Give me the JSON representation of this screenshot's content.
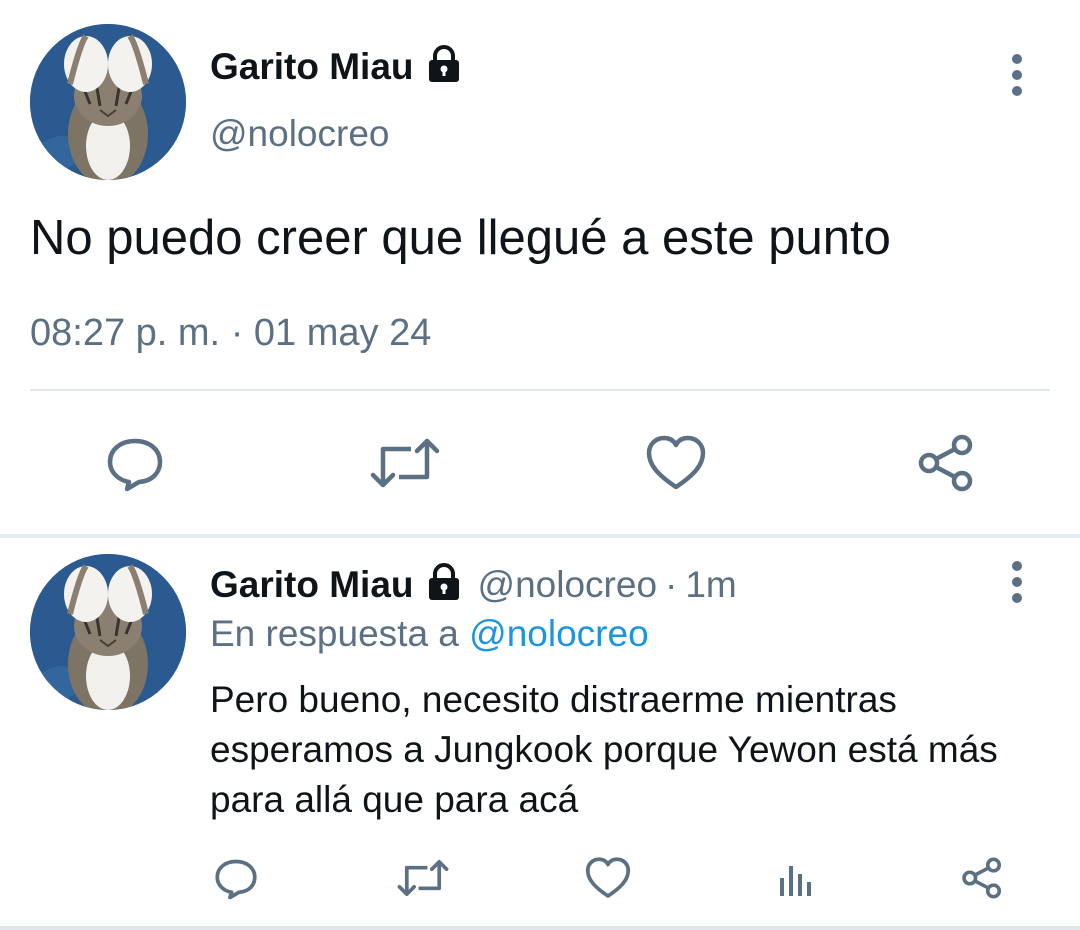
{
  "tweet": {
    "author_name": "Garito Miau",
    "handle": "@nolocreo",
    "text": "No puedo creer que llegué a este punto",
    "time": "08:27 p. m.",
    "separator": "·",
    "date": "01 may 24",
    "author_locked": true,
    "actions": [
      "reply",
      "retweet",
      "like",
      "share"
    ]
  },
  "reply": {
    "author_name": "Garito Miau",
    "handle": "@nolocreo",
    "separator": "·",
    "age": "1m",
    "replying_to_label": "En respuesta a",
    "replying_to_handle": "@nolocreo",
    "text": "Pero bueno, necesito distraerme mientras esperamos a Jungkook porque Yewon está más para allá que para acá",
    "author_locked": true,
    "actions": [
      "reply",
      "retweet",
      "like",
      "analytics",
      "share"
    ]
  },
  "colors": {
    "icon_gray": "#5b7083",
    "link_blue": "#1b95e0",
    "text": "#0f1419",
    "divider": "#e1e8ed"
  }
}
